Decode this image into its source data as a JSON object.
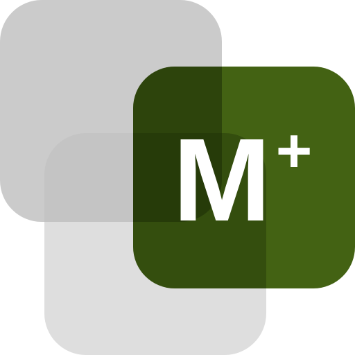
{
  "app_icon": {
    "name": "m-plus-app-icon",
    "letter": "M",
    "superscript": "+",
    "colors": {
      "back_tile": "#bdbdbd",
      "middle_tile": "#c9c9c9",
      "front_tile": "#436213",
      "text": "#ffffff",
      "background": "#ffffff"
    }
  }
}
